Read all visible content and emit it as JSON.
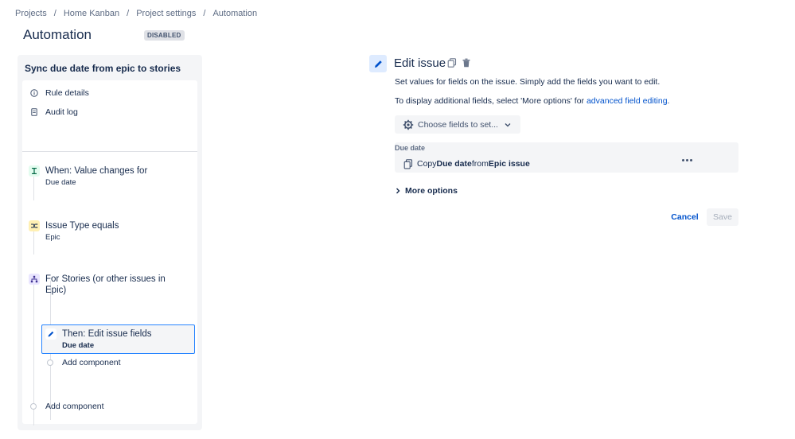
{
  "breadcrumb": [
    "Projects",
    "Home Kanban",
    "Project settings",
    "Automation"
  ],
  "breadcrumb_separator": "/",
  "page": {
    "title": "Automation",
    "status": "DISABLED"
  },
  "rule": {
    "name": "Sync due date from epic to stories",
    "nav": [
      {
        "label": "Rule details",
        "icon": "info-icon"
      },
      {
        "label": "Audit log",
        "icon": "document-icon"
      }
    ],
    "steps": [
      {
        "title": "When: Value changes for",
        "subtitle": "Due date",
        "icon": "trigger-icon",
        "color": "#57d9a3"
      },
      {
        "title": "Issue Type equals",
        "subtitle": "Epic",
        "icon": "condition-icon",
        "color": "#ffe380"
      },
      {
        "title_line1": "For Stories (or other issues in",
        "title_line2": "Epic)",
        "icon": "branch-icon",
        "color": "#eae6ff"
      },
      {
        "title": "Then: Edit issue fields",
        "subtitle": "Due date",
        "icon": "pencil-icon",
        "color": "#0052cc"
      }
    ],
    "add_component_inner": "Add component",
    "add_component_outer": "Add component"
  },
  "editor": {
    "title": "Edit issue",
    "desc1": "Set values for fields on the issue. Simply add the fields you want to edit.",
    "desc2_prefix": "To display additional fields, select 'More options' for ",
    "desc2_link": "advanced field editing",
    "desc2_suffix": ".",
    "choose_fields": "Choose fields to set...",
    "field_label": "Due date",
    "copy_prefix": "Copy ",
    "copy_field": "Due date",
    "copy_middle": " from ",
    "copy_source": "Epic issue",
    "more_options": "More options",
    "cancel": "Cancel",
    "save": "Save"
  },
  "colors": {
    "accent": "#0052cc",
    "selection_border": "#2684ff",
    "panel_bg": "#f4f5f7"
  }
}
